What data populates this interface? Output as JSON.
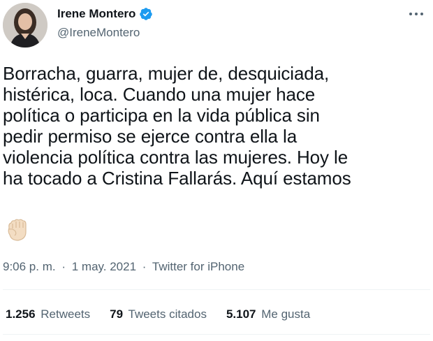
{
  "author": {
    "display_name": "Irene Montero",
    "handle": "@IreneMontero",
    "verified": true
  },
  "tweet": {
    "text_lines": [
      "Borracha, guarra, mujer de, desquiciada,",
      "histérica, loca. Cuando una mujer hace",
      "política o participa en la vida pública sin",
      "pedir permiso se ejerce contra ella la",
      "violencia política contra las mujeres. Hoy le",
      "ha tocado a Cristina Fallarás. Aquí estamos"
    ],
    "emoji": "raised-fist-icon"
  },
  "meta": {
    "time": "9:06 p. m.",
    "separator": "·",
    "date": "1 may. 2021",
    "source": "Twitter for iPhone"
  },
  "stats": {
    "retweets_count": "1.256",
    "retweets_label": "Retweets",
    "quotes_count": "79",
    "quotes_label": "Tweets citados",
    "likes_count": "5.107",
    "likes_label": "Me gusta"
  },
  "colors": {
    "text_primary": "#0f1419",
    "text_secondary": "#536471",
    "verified_blue": "#1d9bf0",
    "divider": "#eff3f4"
  }
}
